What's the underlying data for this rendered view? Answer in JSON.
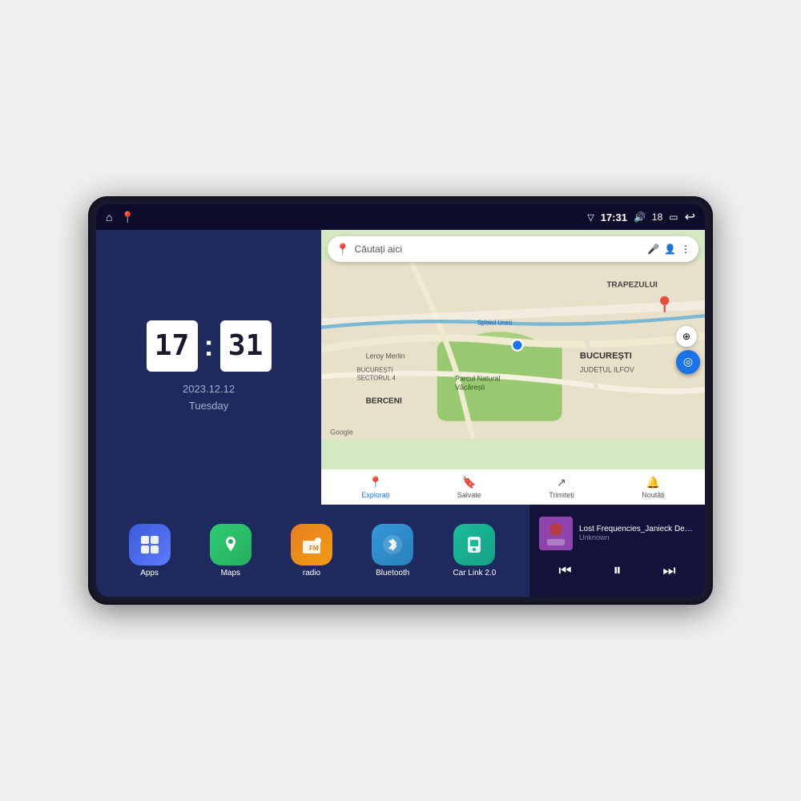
{
  "device": {
    "status_bar": {
      "signal_icon": "▽",
      "time": "17:31",
      "volume_icon": "🔊",
      "battery_level": "18",
      "battery_icon": "▭",
      "back_icon": "↩",
      "home_icon": "⌂",
      "maps_icon": "📍"
    },
    "clock": {
      "hours": "17",
      "minutes": "31",
      "date": "2023.12.12",
      "day": "Tuesday"
    },
    "map": {
      "search_placeholder": "Căutați aici",
      "search_placeholder_key": "search_placeholder",
      "bottom_items": [
        {
          "label": "Explorați",
          "active": true,
          "icon": "📍"
        },
        {
          "label": "Salvate",
          "active": false,
          "icon": "🔖"
        },
        {
          "label": "Trimiteți",
          "active": false,
          "icon": "🔄"
        },
        {
          "label": "Noutăți",
          "active": false,
          "icon": "🔔"
        }
      ],
      "labels": [
        "TRAPEZULUI",
        "BUCUREȘTI",
        "JUDEȚUL ILFOV",
        "BERCENI",
        "Parcul Natural Văcărești",
        "Leroy Merlin",
        "BUCUREȘTI SECTORUL 4",
        "Splaiul Unirii"
      ]
    },
    "apps": [
      {
        "id": "apps",
        "label": "Apps",
        "icon": "⊞",
        "class": "app-apps"
      },
      {
        "id": "maps",
        "label": "Maps",
        "icon": "🗺",
        "class": "app-maps"
      },
      {
        "id": "radio",
        "label": "radio",
        "icon": "📻",
        "class": "app-radio"
      },
      {
        "id": "bluetooth",
        "label": "Bluetooth",
        "icon": "⬡",
        "class": "app-bluetooth"
      },
      {
        "id": "carlink",
        "label": "Car Link 2.0",
        "icon": "📱",
        "class": "app-carlink"
      }
    ],
    "music": {
      "title": "Lost Frequencies_Janieck Devy-...",
      "artist": "Unknown",
      "prev_icon": "⏮",
      "play_icon": "⏸",
      "next_icon": "⏭"
    }
  }
}
